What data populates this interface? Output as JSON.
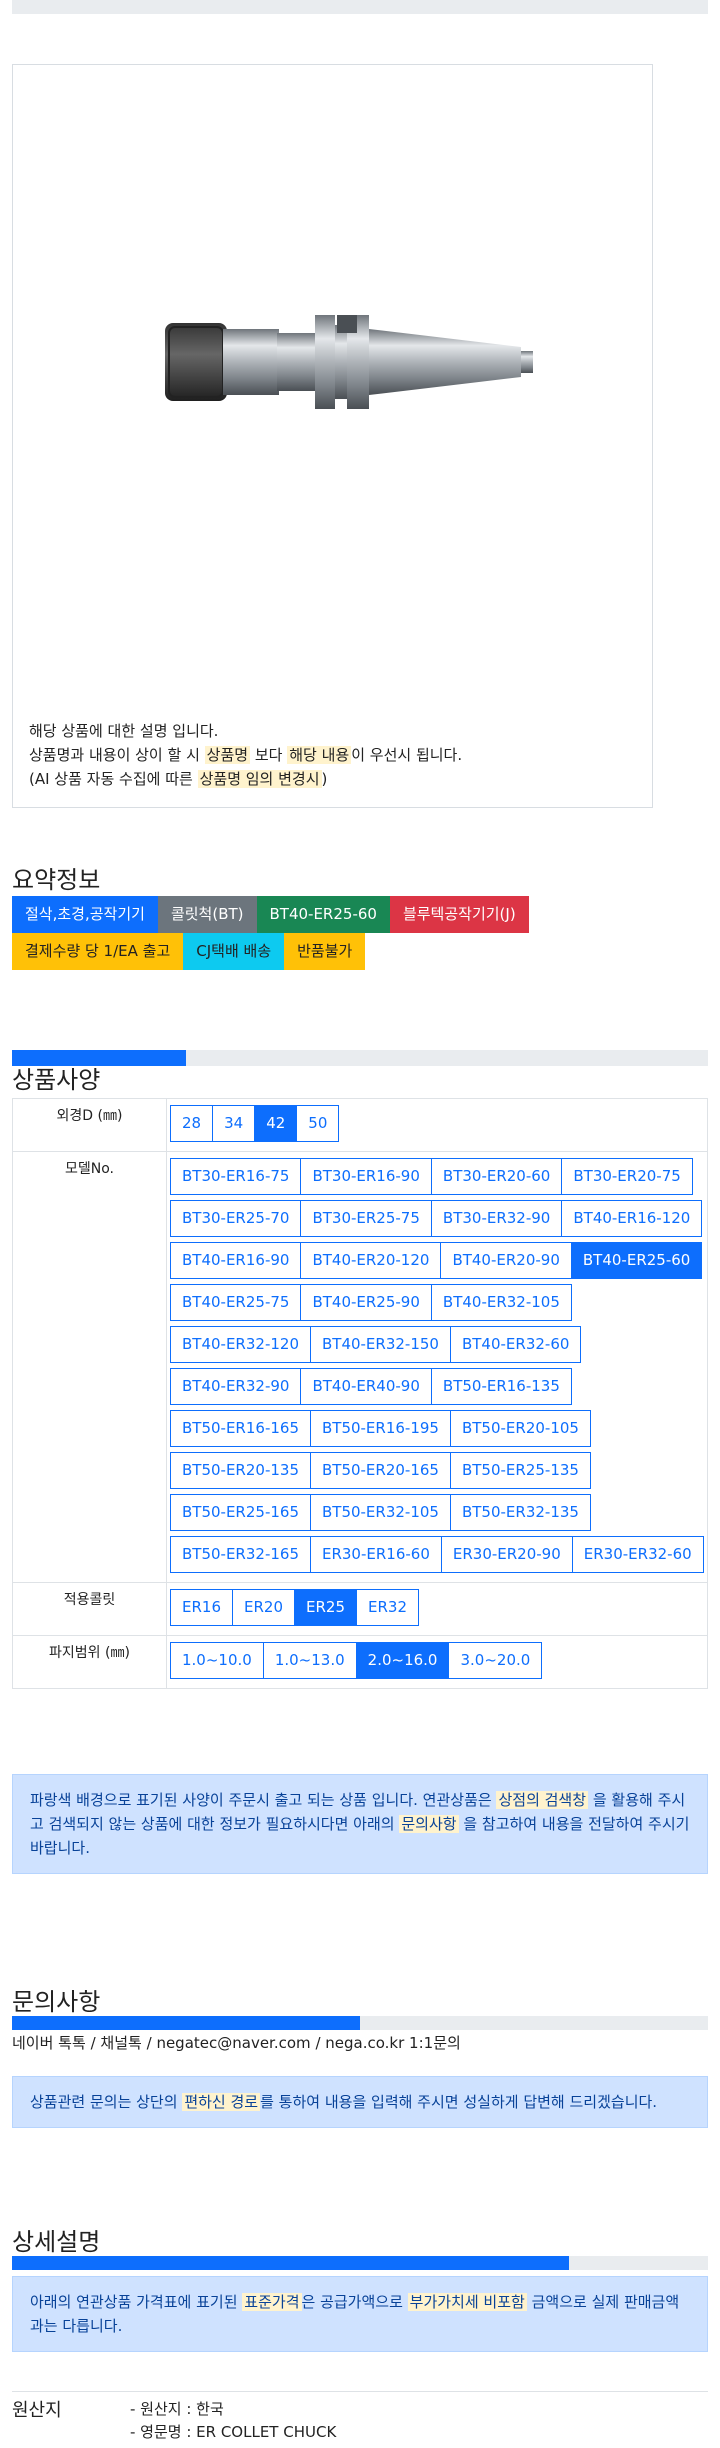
{
  "image_notes": {
    "line1": "해당 상품에 대한 설명 입니다.",
    "line2_a": "상품명과 내용이 상이 할 시",
    "line2_hl1": "상품명",
    "line2_b": "보다",
    "line2_hl2": "해당 내용",
    "line2_c": "이 우선시 됩니다.",
    "line3_a": "(AI 상품 자동 수집에 따른",
    "line3_hl": "상품명 임의 변경시",
    "line3_b": ")"
  },
  "summary": {
    "title": "요약정보",
    "badges": [
      "절삭,초경,공작기기",
      "콜릿척(BT)",
      "BT40-ER25-60",
      "블루텍공작기기(J)",
      "결제수량 당 1/EA 출고",
      "CJ택배 배송",
      "반품불가"
    ]
  },
  "specs": {
    "title": "상품사양",
    "progress": 0.25,
    "outer_d": {
      "label": "외경D (㎜)",
      "options": [
        "28",
        "34",
        "42",
        "50"
      ],
      "selected": "42"
    },
    "model": {
      "label": "모델No.",
      "options": [
        "BT30-ER16-75",
        "BT30-ER16-90",
        "BT30-ER20-60",
        "BT30-ER20-75",
        "BT30-ER25-70",
        "BT30-ER25-75",
        "BT30-ER32-90",
        "BT40-ER16-120",
        "BT40-ER16-90",
        "BT40-ER20-120",
        "BT40-ER20-90",
        "BT40-ER25-60",
        "BT40-ER25-75",
        "BT40-ER25-90",
        "BT40-ER32-105",
        "BT40-ER32-120",
        "BT40-ER32-150",
        "BT40-ER32-60",
        "BT40-ER32-90",
        "BT40-ER40-90",
        "BT50-ER16-135",
        "BT50-ER16-165",
        "BT50-ER16-195",
        "BT50-ER20-105",
        "BT50-ER20-135",
        "BT50-ER20-165",
        "BT50-ER25-135",
        "BT50-ER25-165",
        "BT50-ER32-105",
        "BT50-ER32-135",
        "BT50-ER32-165",
        "ER30-ER16-60",
        "ER30-ER20-90",
        "ER30-ER32-60"
      ],
      "selected": "BT40-ER25-60"
    },
    "collet": {
      "label": "적용콜릿",
      "options": [
        "ER16",
        "ER20",
        "ER25",
        "ER32"
      ],
      "selected": "ER25"
    },
    "grip": {
      "label": "파지범위 (㎜)",
      "options": [
        "1.0~10.0",
        "1.0~13.0",
        "2.0~16.0",
        "3.0~20.0"
      ],
      "selected": "2.0~16.0"
    },
    "notice": {
      "a": "파랑색 배경으로 표기된 사양이 주문시 출고 되는 상품 입니다. 연관상품은",
      "hl1": "상점의 검색창",
      "b": "을 활용해 주시고 검색되지 않는 상품에 대한 정보가 필요하시다면 아래의",
      "hl2": "문의사항",
      "c": "을 참고하여 내용을 전달하여 주시기 바랍니다."
    }
  },
  "inquiry": {
    "title": "문의사항",
    "progress": 0.5,
    "contacts": [
      "네이버 톡톡",
      "채널톡",
      "negatec@naver.com",
      "nega.co.kr 1:1문의"
    ],
    "separator": "/",
    "notice": {
      "a": "상품관련 문의는 상단의",
      "hl": "편하신 경로",
      "b": "를 통하여 내용을 입력해 주시면 성실하게 답변해 드리겠습니다."
    }
  },
  "detail": {
    "title": "상세설명",
    "progress": 0.8,
    "notice": {
      "a": "아래의 연관상품 가격표에 표기된",
      "hl1": "표준가격",
      "b": "은 공급가액으로",
      "hl2": "부가가치세 비포함",
      "c": "금액으로 실제 판매금액과는 다릅니다."
    }
  },
  "origin": {
    "label": "원산지",
    "items": [
      "- 원산지 : 한국",
      "- 영문명 : ER COLLET CHUCK"
    ]
  },
  "colors": {
    "primary": "#0d6efd",
    "notice_bg": "#cfe2ff",
    "highlight": "#fff3cd"
  }
}
